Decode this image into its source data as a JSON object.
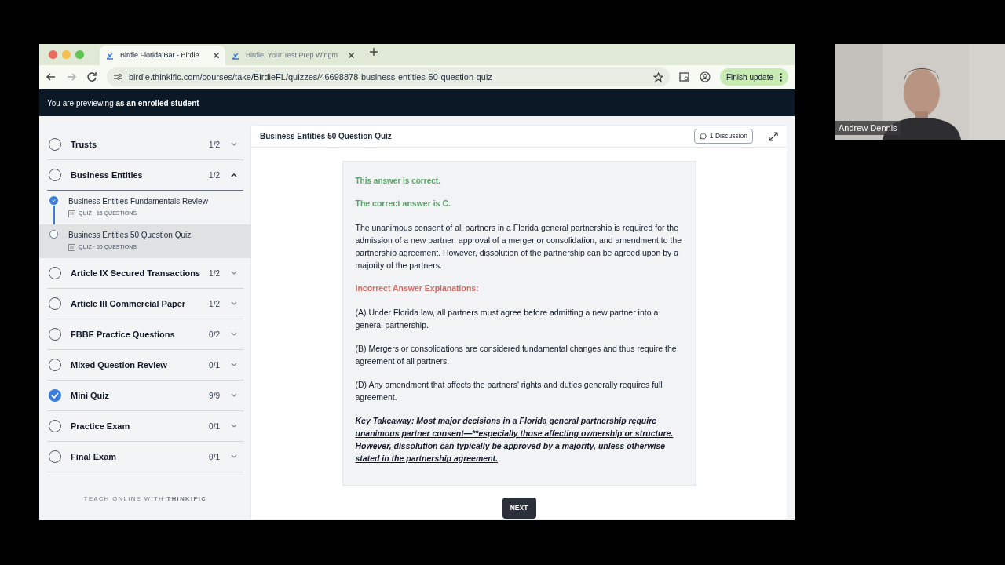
{
  "browser": {
    "tabs": [
      {
        "title": "Birdie Florida Bar - Birdie",
        "selected": true
      },
      {
        "title": "Birdie, Your Test Prep Wingm",
        "selected": false
      }
    ],
    "url": "birdie.thinkific.com/courses/take/BirdieFL/quizzes/46698878-business-entities-50-question-quiz",
    "update_button": "Finish update"
  },
  "preview_banner": "You are previewing **as an enrolled student**",
  "sidebar": {
    "sections": [
      {
        "title": "Trusts",
        "count": "1/2",
        "checked": false,
        "expanded": false
      },
      {
        "title": "Business Entities",
        "count": "1/2",
        "checked": false,
        "expanded": true,
        "children": [
          {
            "title": "Business Entities Fundamentals Review",
            "meta": "QUIZ · 15 QUESTIONS",
            "checked": true,
            "selected": false
          },
          {
            "title": "Business Entities 50 Question Quiz",
            "meta": "QUIZ · 50 QUESTIONS",
            "checked": false,
            "selected": true
          }
        ]
      },
      {
        "title": "Article IX Secured Transactions",
        "count": "1/2",
        "checked": false,
        "expanded": false
      },
      {
        "title": "Article III Commercial Paper",
        "count": "1/2",
        "checked": false,
        "expanded": false
      },
      {
        "title": "FBBE Practice Questions",
        "count": "0/2",
        "checked": false,
        "expanded": false
      },
      {
        "title": "Mixed Question Review",
        "count": "0/1",
        "checked": false,
        "expanded": false
      },
      {
        "title": "Mini Quiz",
        "count": "9/9",
        "checked": true,
        "expanded": false
      },
      {
        "title": "Practice Exam",
        "count": "0/1",
        "checked": false,
        "expanded": false
      },
      {
        "title": "Final Exam",
        "count": "0/1",
        "checked": false,
        "expanded": false
      }
    ],
    "footer": "TEACH ONLINE WITH **THINKIFIC**"
  },
  "lesson": {
    "title": "Business Entities 50 Question Quiz",
    "discussion_button": "1 Discussion"
  },
  "feedback": {
    "blocks": [
      {
        "kind": "status",
        "text": "This answer is correct."
      },
      {
        "kind": "correct",
        "text": "The correct answer is C."
      },
      {
        "kind": "body",
        "text": "The unanimous consent of all partners in a Florida general partnership is required for the admission of a new partner, approval of a merger or consolidation, and amendment to the partnership agreement. However, dissolution of the partnership can be agreed upon by a majority of the partners."
      },
      {
        "kind": "incorrect",
        "text": "Incorrect Answer Explanations:"
      },
      {
        "kind": "body",
        "text": "(A) Under Florida law, all partners must agree before admitting a new partner into a general partnership."
      },
      {
        "kind": "body",
        "text": "(B) Mergers or consolidations are considered fundamental changes and thus require the agreement of all partners."
      },
      {
        "kind": "body",
        "text": "(D) Any amendment that affects the partners' rights and duties generally requires full agreement."
      },
      {
        "kind": "takeaway",
        "text": "Key Takeaway: Most major decisions in a Florida general partnership require unanimous partner consent—**especially those affecting ownership or structure. However, dissolution can typically be approved by a majority, unless otherwise stated in the partnership agreement."
      }
    ],
    "next_button": "NEXT"
  },
  "webcam": {
    "kind": "picture",
    "name": "Andrew Dennis"
  }
}
